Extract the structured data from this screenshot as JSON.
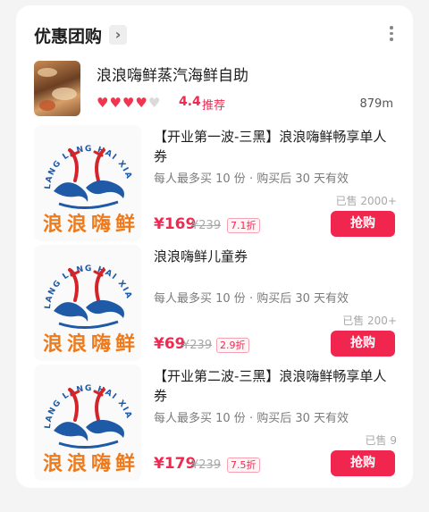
{
  "section": {
    "title": "优惠团购"
  },
  "shop": {
    "name": "浪浪嗨鲜蒸汽海鲜自助",
    "hearts_filled": 4,
    "hearts_total": 5,
    "rating": "4.4",
    "recommend": "推荐",
    "distance": "879m"
  },
  "deals": [
    {
      "title": "【开业第一波-三黑】浪浪嗨鲜畅享单人券",
      "limit": "每人最多买 10 份 · 购买后 30 天有效",
      "sold": "已售 2000+",
      "price": "¥169",
      "orig": "¥239",
      "discount": "7.1折",
      "buy": "抢购"
    },
    {
      "title": "浪浪嗨鲜儿童券",
      "limit": "每人最多买 10 份 · 购买后 30 天有效",
      "sold": "已售 200+",
      "price": "¥69",
      "orig": "¥239",
      "discount": "2.9折",
      "buy": "抢购"
    },
    {
      "title": "【开业第二波-三黑】浪浪嗨鲜畅享单人券",
      "limit": "每人最多买 10 份 · 购买后 30 天有效",
      "sold": "已售 9",
      "price": "¥179",
      "orig": "¥239",
      "discount": "7.5折",
      "buy": "抢购"
    }
  ],
  "logo": {
    "arc_text": "LANG LANG HAI XIAN",
    "chars": [
      "浪",
      "浪",
      "嗨",
      "鲜"
    ]
  },
  "colors": {
    "accent": "#f0264e",
    "logo_blue": "#1f5aa6",
    "logo_orange": "#ee7a1c",
    "logo_red": "#d4242a"
  }
}
